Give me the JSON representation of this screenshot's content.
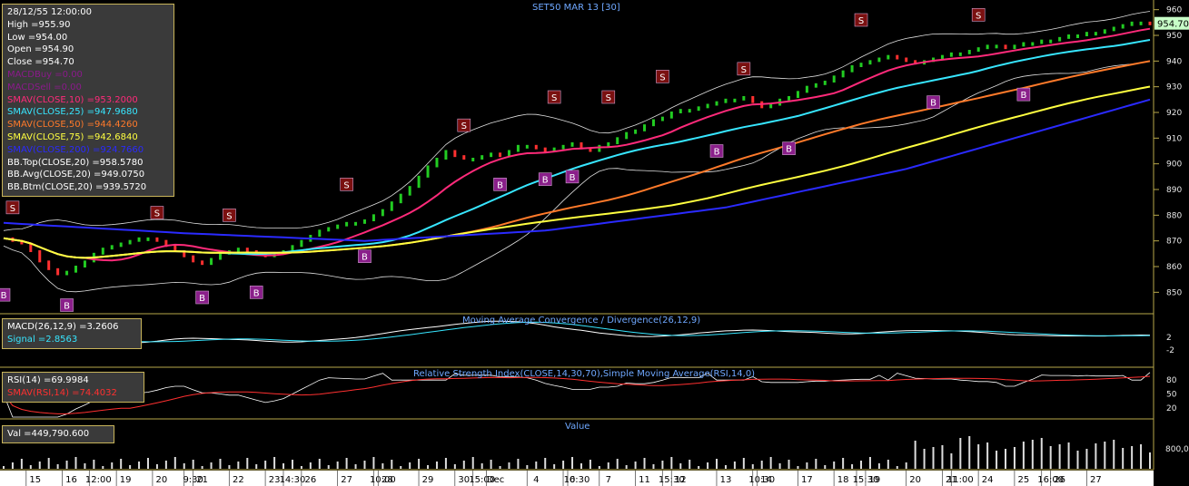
{
  "chart_title": "SET50 MAR 13   [30]",
  "last_price_tag": "954.70",
  "legend": [
    {
      "text": "28/12/55 12:00:00",
      "color": "#ffffff"
    },
    {
      "text": "High  =955.90",
      "color": "#ffffff"
    },
    {
      "text": "Low  =954.00",
      "color": "#ffffff"
    },
    {
      "text": "Open  =954.90",
      "color": "#ffffff"
    },
    {
      "text": "Close  =954.70",
      "color": "#ffffff"
    },
    {
      "text": "MACDBuy  =0.00",
      "color": "#8b1a8b"
    },
    {
      "text": "MACDSell  =0.00",
      "color": "#8b1a8b"
    },
    {
      "text": "SMAV(CLOSE,10)    =953.2000",
      "color": "#ff2a7a"
    },
    {
      "text": "SMAV(CLOSE,25)    =947.9680",
      "color": "#37e6ff"
    },
    {
      "text": "SMAV(CLOSE,50)    =944.4260",
      "color": "#ff7a2a"
    },
    {
      "text": "SMAV(CLOSE,75)    =942.6840",
      "color": "#ffff40"
    },
    {
      "text": "SMAV(CLOSE,200)   =924.7660",
      "color": "#2a2aff"
    },
    {
      "text": "BB.Top(CLOSE,20)    =958.5780",
      "color": "#ffffff"
    },
    {
      "text": "BB.Avg(CLOSE,20)    =949.0750",
      "color": "#ffffff"
    },
    {
      "text": "BB.Btm(CLOSE,20)    =939.5720",
      "color": "#ffffff"
    }
  ],
  "macd_panel": {
    "title": "Moving Average Convergence / Divergence(26,12,9)",
    "legend": [
      {
        "text": "MACD(26,12,9)    =3.2606",
        "color": "#ffffff"
      },
      {
        "text": "Signal    =2.8563",
        "color": "#37e6ff"
      }
    ],
    "ticks": [
      "2",
      "-2"
    ]
  },
  "rsi_panel": {
    "title": "Relative Strength Index(CLOSE,14,30,70),Simple Moving Average(RSI,14,0)",
    "legend": [
      {
        "text": "RSI(14)    =69.9984",
        "color": "#ffffff"
      },
      {
        "text": "SMAV(RSI,14)    =74.4032",
        "color": "#ff3030"
      }
    ],
    "ticks": [
      "80",
      "50",
      "20"
    ]
  },
  "value_panel": {
    "title": "Value",
    "legend": [
      {
        "text": "Val    =449,790.600",
        "color": "#ffffff"
      }
    ],
    "ticks": [
      "800,000"
    ]
  },
  "x_axis": {
    "labels": [
      {
        "t": "15",
        "i": 3.5
      },
      {
        "t": "16",
        "i": 7.5
      },
      {
        "t": "12:00",
        "i": 10.5
      },
      {
        "t": "19",
        "i": 13.5
      },
      {
        "t": "20",
        "i": 17.5
      },
      {
        "t": "9:30",
        "i": 21
      },
      {
        "t": "21",
        "i": 22
      },
      {
        "t": "22",
        "i": 26
      },
      {
        "t": "23",
        "i": 30
      },
      {
        "t": "14:30",
        "i": 32
      },
      {
        "t": "26",
        "i": 34
      },
      {
        "t": "27",
        "i": 38
      },
      {
        "t": "10:00",
        "i": 42
      },
      {
        "t": "28",
        "i": 42.5
      },
      {
        "t": "29",
        "i": 47
      },
      {
        "t": "30",
        "i": 51
      },
      {
        "t": "15:00",
        "i": 53
      },
      {
        "t": "Dec",
        "i": 54.5
      },
      {
        "t": "4",
        "i": 59
      },
      {
        "t": "6",
        "i": 63
      },
      {
        "t": "10:30",
        "i": 63.5
      },
      {
        "t": "7",
        "i": 67
      },
      {
        "t": "11",
        "i": 71
      },
      {
        "t": "15:30",
        "i": 74
      },
      {
        "t": "12",
        "i": 75
      },
      {
        "t": "13",
        "i": 80
      },
      {
        "t": "10:30",
        "i": 84
      },
      {
        "t": "14",
        "i": 84.5
      },
      {
        "t": "17",
        "i": 89
      },
      {
        "t": "18",
        "i": 93
      },
      {
        "t": "15:30",
        "i": 95.5
      },
      {
        "t": "19",
        "i": 96.5
      },
      {
        "t": "20",
        "i": 101
      },
      {
        "t": "21",
        "i": 105
      },
      {
        "t": "11:00",
        "i": 106
      },
      {
        "t": "24",
        "i": 109
      },
      {
        "t": "25",
        "i": 113
      },
      {
        "t": "26",
        "i": 117
      },
      {
        "t": "16:00",
        "i": 116
      },
      {
        "t": "27",
        "i": 121
      }
    ]
  },
  "chart_data": {
    "type": "line",
    "ylim": [
      842,
      962
    ],
    "yticks": [
      850,
      860,
      870,
      880,
      890,
      900,
      910,
      920,
      930,
      940,
      950,
      960
    ],
    "x_count": 128,
    "close": [
      871,
      870,
      869,
      866,
      862,
      859,
      857,
      858,
      860,
      862,
      865,
      867,
      868,
      869,
      870,
      871,
      871,
      870,
      868,
      866,
      864,
      862,
      861,
      863,
      865,
      866,
      867,
      866,
      865,
      864,
      865,
      866,
      868,
      870,
      872,
      874,
      875,
      876,
      877,
      877,
      878,
      880,
      882,
      885,
      888,
      891,
      895,
      899,
      902,
      905,
      903,
      902,
      902,
      903,
      904,
      903,
      905,
      907,
      907,
      906,
      905,
      906,
      907,
      908,
      906,
      905,
      907,
      908,
      910,
      912,
      913,
      915,
      917,
      918,
      920,
      921,
      921,
      922,
      923,
      924,
      925,
      925,
      926,
      924,
      922,
      923,
      925,
      926,
      928,
      930,
      931,
      932,
      934,
      936,
      938,
      939,
      940,
      941,
      942,
      941,
      940,
      939,
      940,
      941,
      942,
      943,
      943,
      944,
      945,
      946,
      946,
      945,
      946,
      947,
      947,
      948,
      948,
      949,
      950,
      950,
      951,
      951,
      952,
      953,
      954,
      955,
      955,
      954.7
    ],
    "series": [
      {
        "name": "SMAV(CLOSE,10)",
        "color": "#ff2a7a",
        "window": 10
      },
      {
        "name": "SMAV(CLOSE,25)",
        "color": "#37e6ff",
        "window": 25
      },
      {
        "name": "SMAV(CLOSE,50)",
        "color": "#ff7a2a",
        "window": 50
      },
      {
        "name": "SMAV(CLOSE,75)",
        "color": "#ffff40",
        "window": 75
      },
      {
        "name": "SMAV(CLOSE,200)",
        "color": "#2a2aff",
        "values_at": [
          [
            0,
            877
          ],
          [
            20,
            873
          ],
          [
            40,
            870
          ],
          [
            60,
            874
          ],
          [
            80,
            883
          ],
          [
            100,
            898
          ],
          [
            115,
            913
          ],
          [
            127,
            925
          ]
        ]
      }
    ],
    "buy_signals": [
      {
        "i": 0,
        "v": 849
      },
      {
        "i": 7,
        "v": 845
      },
      {
        "i": 22,
        "v": 848
      },
      {
        "i": 28,
        "v": 850
      },
      {
        "i": 40,
        "v": 864
      },
      {
        "i": 55,
        "v": 892
      },
      {
        "i": 60,
        "v": 894
      },
      {
        "i": 63,
        "v": 895
      },
      {
        "i": 79,
        "v": 905
      },
      {
        "i": 87,
        "v": 906
      },
      {
        "i": 103,
        "v": 924
      },
      {
        "i": 113,
        "v": 927
      }
    ],
    "sell_signals": [
      {
        "i": 1,
        "v": 883
      },
      {
        "i": 17,
        "v": 881
      },
      {
        "i": 25,
        "v": 880
      },
      {
        "i": 38,
        "v": 892
      },
      {
        "i": 51,
        "v": 915
      },
      {
        "i": 61,
        "v": 926
      },
      {
        "i": 67,
        "v": 926
      },
      {
        "i": 73,
        "v": 934
      },
      {
        "i": 82,
        "v": 937
      },
      {
        "i": 95,
        "v": 956
      },
      {
        "i": 108,
        "v": 958
      }
    ]
  }
}
